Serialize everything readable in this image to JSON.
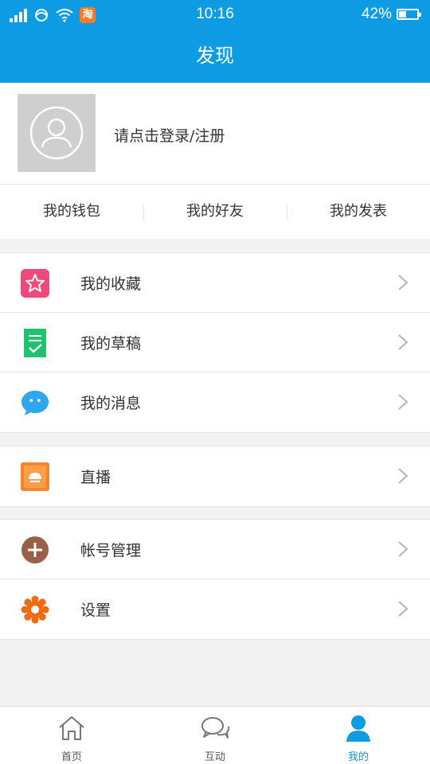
{
  "status_bar": {
    "time": "10:16",
    "battery_percent": "42%",
    "battery_level": 0.42,
    "app_badge": "淘"
  },
  "header": {
    "title": "发现"
  },
  "profile": {
    "login_text": "请点击登录/注册"
  },
  "quick_links": [
    {
      "label": "我的钱包"
    },
    {
      "label": "我的好友"
    },
    {
      "label": "我的发表"
    }
  ],
  "menu_groups": [
    [
      {
        "label": "我的收藏",
        "icon": "star-icon",
        "color": "#f0487a"
      },
      {
        "label": "我的草稿",
        "icon": "draft-icon",
        "color": "#21c26e"
      },
      {
        "label": "我的消息",
        "icon": "message-icon",
        "color": "#2ea7ef"
      }
    ],
    [
      {
        "label": "直播",
        "icon": "live-icon",
        "color": "#f7842b"
      }
    ],
    [
      {
        "label": "帐号管理",
        "icon": "plus-circle-icon",
        "color": "#9a6047"
      },
      {
        "label": "设置",
        "icon": "gear-icon",
        "color": "#f06b16"
      }
    ]
  ],
  "tabbar": {
    "tabs": [
      {
        "label": "首页",
        "icon": "home-icon",
        "active": false
      },
      {
        "label": "互动",
        "icon": "chat-bubbles-icon",
        "active": false
      },
      {
        "label": "我的",
        "icon": "person-icon",
        "active": true
      }
    ],
    "active_color": "#0d9be3"
  },
  "colors": {
    "brand": "#0d9be3",
    "background": "#f2f2f2"
  }
}
